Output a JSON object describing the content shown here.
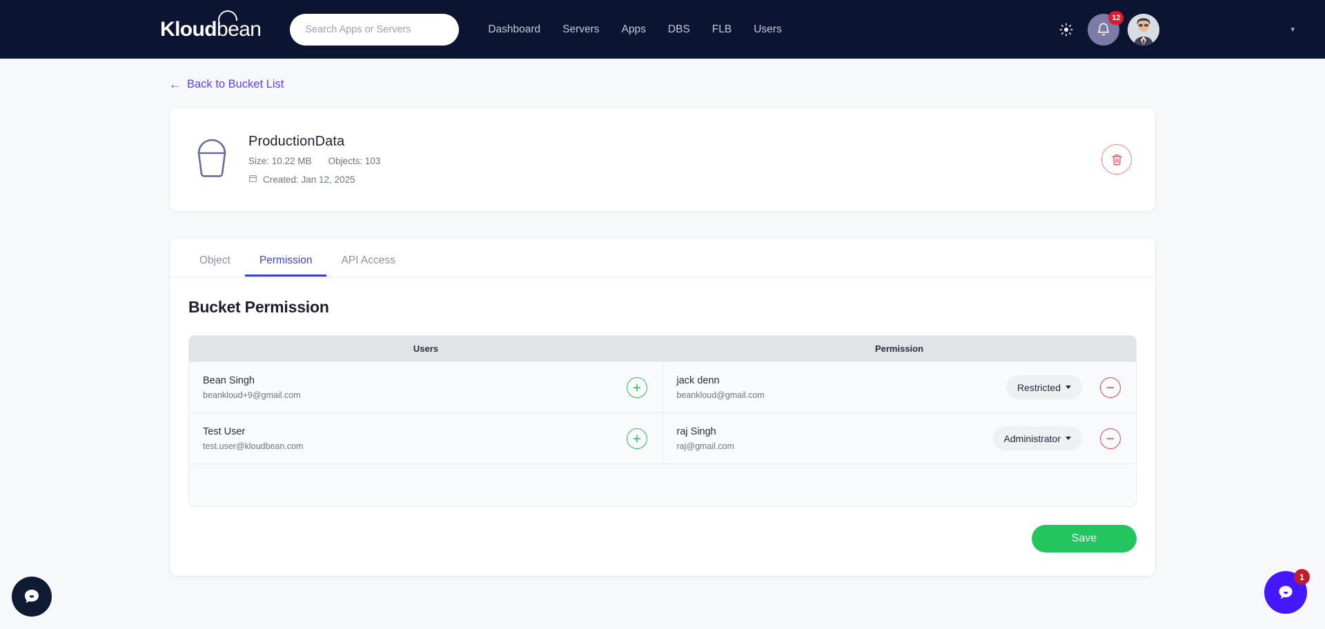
{
  "navbar": {
    "logo_k": "Kloud",
    "logo_b": "bean",
    "search_placeholder": "Search Apps or Servers",
    "search_value": "",
    "links": [
      {
        "label": "Dashboard"
      },
      {
        "label": "Servers"
      },
      {
        "label": "Apps"
      },
      {
        "label": "DBS"
      },
      {
        "label": "FLB"
      },
      {
        "label": "Users"
      }
    ],
    "theme_icon": "sun-icon",
    "notification_icon": "bell-icon",
    "notification_count": "12",
    "avatar_icon": "user-avatar",
    "user_caret_icon": "chevron-down-icon"
  },
  "back": {
    "arrow": "←",
    "label": "Back to Bucket List"
  },
  "bucket": {
    "icon": "bucket-icon",
    "name": "ProductionData",
    "size_label": "Size: 10.22 MB",
    "objects_label": "Objects: 103",
    "calendar_icon": "calendar-icon",
    "created_label": "Created: Jan 12, 2025",
    "delete_icon": "trash-icon"
  },
  "tabs": [
    {
      "label": "Object",
      "active": false
    },
    {
      "label": "Permission",
      "active": true
    },
    {
      "label": "API Access",
      "active": false
    }
  ],
  "panel": {
    "title": "Bucket Permission",
    "columns": {
      "users": "Users",
      "permission": "Permission"
    },
    "rows": [
      {
        "user": {
          "name": "Bean Singh",
          "email": "beankloud+9@gmail.com"
        },
        "add_icon": "plus-circle-icon",
        "member": {
          "name": "jack denn",
          "email": "beankloud@gmail.com"
        },
        "permission": "Restricted",
        "remove_icon": "minus-circle-icon"
      },
      {
        "user": {
          "name": "Test User",
          "email": "test.user@kloudbean.com"
        },
        "add_icon": "plus-circle-icon",
        "member": {
          "name": "raj Singh",
          "email": "raj@gmail.com"
        },
        "permission": "Administrator",
        "remove_icon": "minus-circle-icon"
      }
    ],
    "save_label": "Save"
  },
  "widgets": {
    "left_chat_icon": "chat-bubble-icon",
    "right_chat_icon": "chat-bubble-icon",
    "right_chat_badge": "1"
  },
  "colors": {
    "navbar_bg": "#0b1431",
    "accent_purple": "#5b41e6",
    "tab_active": "#3c41d4",
    "save_green": "#22c55e",
    "danger_red": "#e9414a",
    "add_green": "#26bd4e",
    "badge_red": "#e8182a"
  }
}
